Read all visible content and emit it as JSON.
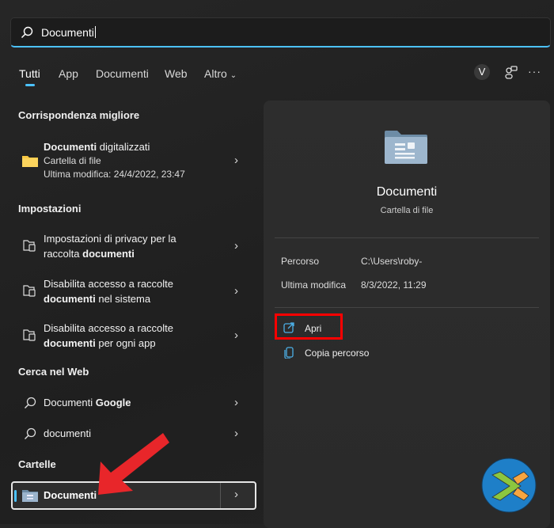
{
  "search": {
    "value": "Documenti"
  },
  "tabs": [
    {
      "label": "Tutti"
    },
    {
      "label": "App"
    },
    {
      "label": "Documenti"
    },
    {
      "label": "Web"
    },
    {
      "label": "Altro"
    }
  ],
  "toolbar": {
    "avatar_letter": "V"
  },
  "best_match": {
    "heading": "Corrispondenza migliore",
    "title_bold": "Documenti",
    "title_rest": " digitalizzati",
    "type": "Cartella di file",
    "modified": "Ultima modifica: 24/4/2022, 23:47"
  },
  "settings": {
    "heading": "Impostazioni",
    "items": [
      {
        "l1": "Impostazioni di privacy per la",
        "l2a": "raccolta ",
        "l2b": "documenti",
        "l2c": ""
      },
      {
        "l1": "Disabilita accesso a raccolte",
        "l2a": "",
        "l2b": "documenti",
        "l2c": " nel sistema"
      },
      {
        "l1": "Disabilita accesso a raccolte",
        "l2a": "",
        "l2b": "documenti",
        "l2c": " per ogni app"
      }
    ]
  },
  "web": {
    "heading": "Cerca nel Web",
    "items": [
      {
        "a": "Documenti ",
        "b": "Google"
      },
      {
        "a": "documenti",
        "b": ""
      }
    ]
  },
  "folders": {
    "heading": "Cartelle",
    "items": [
      {
        "label": "Documenti"
      }
    ]
  },
  "detail": {
    "title": "Documenti",
    "subtitle": "Cartella di file",
    "props": [
      {
        "k": "Percorso",
        "v": "C:\\Users\\roby-"
      },
      {
        "k": "Ultima modifica",
        "v": "8/3/2022, 11:29"
      }
    ],
    "actions": [
      {
        "label": "Apri"
      },
      {
        "label": "Copia percorso"
      }
    ]
  },
  "colors": {
    "accent": "#4cc2ff",
    "highlight": "#ff0000",
    "arrow": "#e8262a"
  }
}
